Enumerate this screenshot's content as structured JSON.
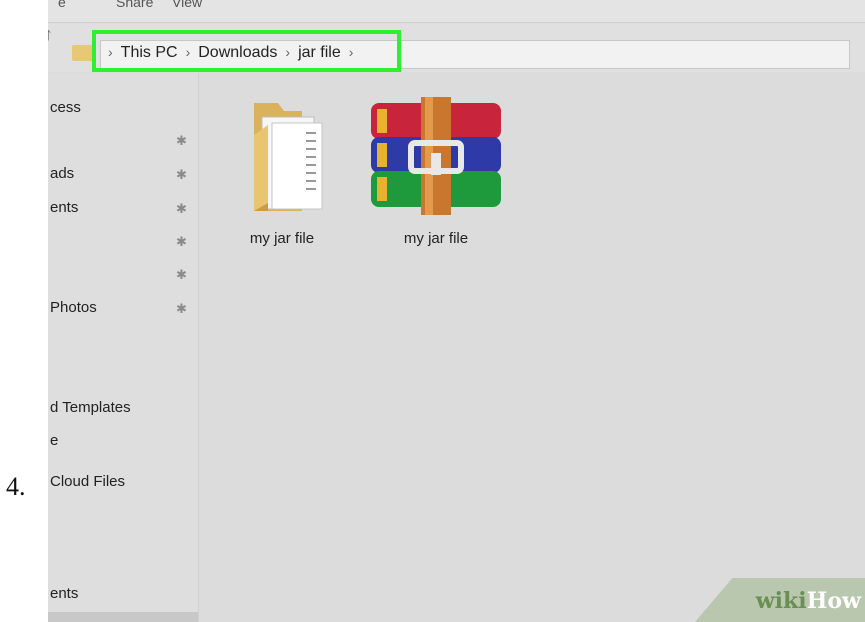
{
  "step": {
    "number": "4."
  },
  "ribbon": {
    "tabs": [
      "e",
      "Share",
      "View"
    ]
  },
  "address": {
    "crumbs": [
      "This PC",
      "Downloads",
      "jar file"
    ],
    "separator": "›",
    "highlight_color": "#2df12d"
  },
  "sidebar": {
    "items": [
      {
        "label": "cess",
        "pinned": false
      },
      {
        "label": "",
        "pinned": true
      },
      {
        "label": "ads",
        "pinned": true
      },
      {
        "label": "ents",
        "pinned": true
      },
      {
        "label": "",
        "pinned": true
      },
      {
        "label": "",
        "pinned": true
      },
      {
        "label": "Photos",
        "pinned": true
      },
      {
        "label": "d Templates",
        "pinned": false
      },
      {
        "label": "e",
        "pinned": false
      },
      {
        "label": "Cloud Files",
        "pinned": false
      },
      {
        "label": "ents",
        "pinned": false
      }
    ],
    "pin_glyph": "✱"
  },
  "files": [
    {
      "name": "my jar file",
      "icon": "folder-icon"
    },
    {
      "name": "my jar file",
      "icon": "winrar-archive-icon"
    }
  ],
  "watermark": {
    "part1": "wiki",
    "part2": "How"
  }
}
